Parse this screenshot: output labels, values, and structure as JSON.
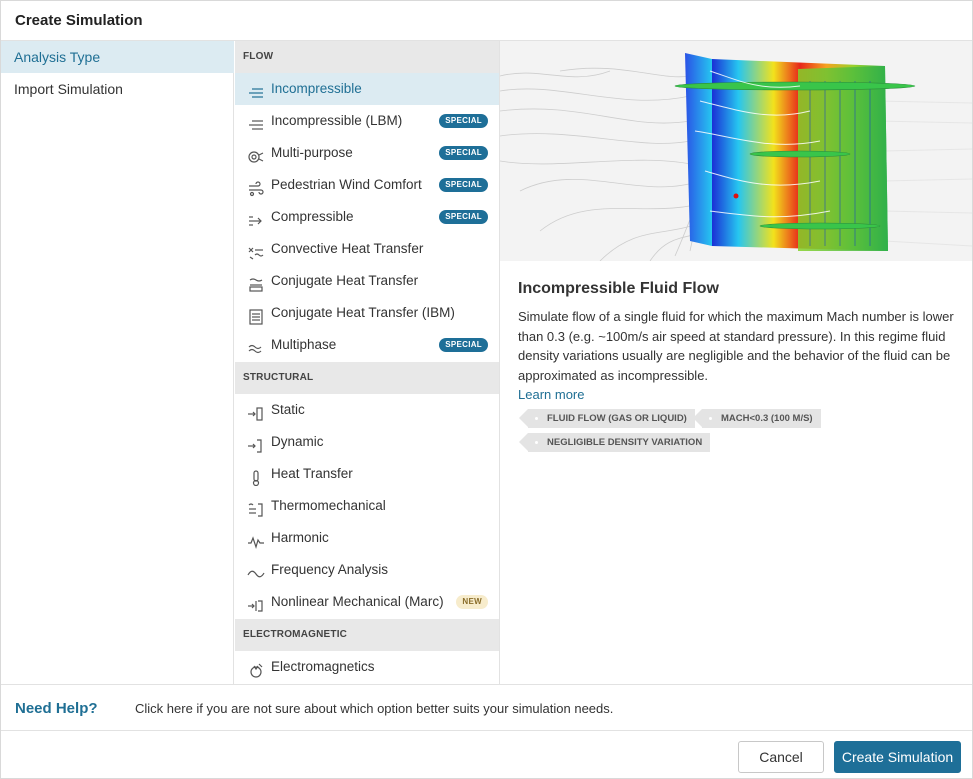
{
  "dialog": {
    "title": "Create Simulation"
  },
  "left_nav": {
    "items": [
      {
        "label": "Analysis Type",
        "active": true
      },
      {
        "label": "Import Simulation",
        "active": false
      }
    ]
  },
  "groups": [
    {
      "label": "FLOW",
      "items": [
        {
          "label": "Incompressible",
          "icon": "incompressible-icon",
          "badge": "",
          "active": true
        },
        {
          "label": "Incompressible (LBM)",
          "icon": "incompressible-lbm-icon",
          "badge": "SPECIAL"
        },
        {
          "label": "Multi-purpose",
          "icon": "multi-purpose-icon",
          "badge": "SPECIAL"
        },
        {
          "label": "Pedestrian Wind Comfort",
          "icon": "wind-comfort-icon",
          "badge": "SPECIAL"
        },
        {
          "label": "Compressible",
          "icon": "compressible-icon",
          "badge": "SPECIAL"
        },
        {
          "label": "Convective Heat Transfer",
          "icon": "convective-heat-icon",
          "badge": ""
        },
        {
          "label": "Conjugate Heat Transfer",
          "icon": "conjugate-heat-icon",
          "badge": ""
        },
        {
          "label": "Conjugate Heat Transfer (IBM)",
          "icon": "conjugate-heat-ibm-icon",
          "badge": ""
        },
        {
          "label": "Multiphase",
          "icon": "multiphase-icon",
          "badge": "SPECIAL"
        }
      ]
    },
    {
      "label": "STRUCTURAL",
      "items": [
        {
          "label": "Static",
          "icon": "static-icon",
          "badge": ""
        },
        {
          "label": "Dynamic",
          "icon": "dynamic-icon",
          "badge": ""
        },
        {
          "label": "Heat Transfer",
          "icon": "thermometer-icon",
          "badge": ""
        },
        {
          "label": "Thermomechanical",
          "icon": "thermomechanical-icon",
          "badge": ""
        },
        {
          "label": "Harmonic",
          "icon": "harmonic-icon",
          "badge": ""
        },
        {
          "label": "Frequency Analysis",
          "icon": "frequency-icon",
          "badge": ""
        },
        {
          "label": "Nonlinear Mechanical (Marc)",
          "icon": "nonlinear-icon",
          "badge": "NEW"
        }
      ]
    },
    {
      "label": "ELECTROMAGNETIC",
      "items": [
        {
          "label": "Electromagnetics",
          "icon": "electromagnetics-icon",
          "badge": ""
        }
      ]
    }
  ],
  "detail": {
    "title": "Incompressible Fluid Flow",
    "description": "Simulate flow of a single fluid for which the maximum Mach number is lower than 0.3 (e.g. ~100m/s air speed at standard pressure). In this regime fluid density variations usually are negligible and the behavior of the fluid can be approximated as incompressible.",
    "learn_more": "Learn more",
    "tags": [
      "FLUID FLOW (GAS OR LIQUID)",
      "MACH<0.3 (100 M/S)",
      "NEGLIGIBLE DENSITY VARIATION"
    ]
  },
  "help": {
    "title": "Need Help?",
    "text": "Click here if you are not sure about which option better suits your simulation needs."
  },
  "footer": {
    "cancel_label": "Cancel",
    "create_label": "Create Simulation"
  },
  "colors": {
    "accent": "#1e6f98",
    "active_bg": "#dcebf2",
    "group_bg": "#e8e8e8"
  }
}
